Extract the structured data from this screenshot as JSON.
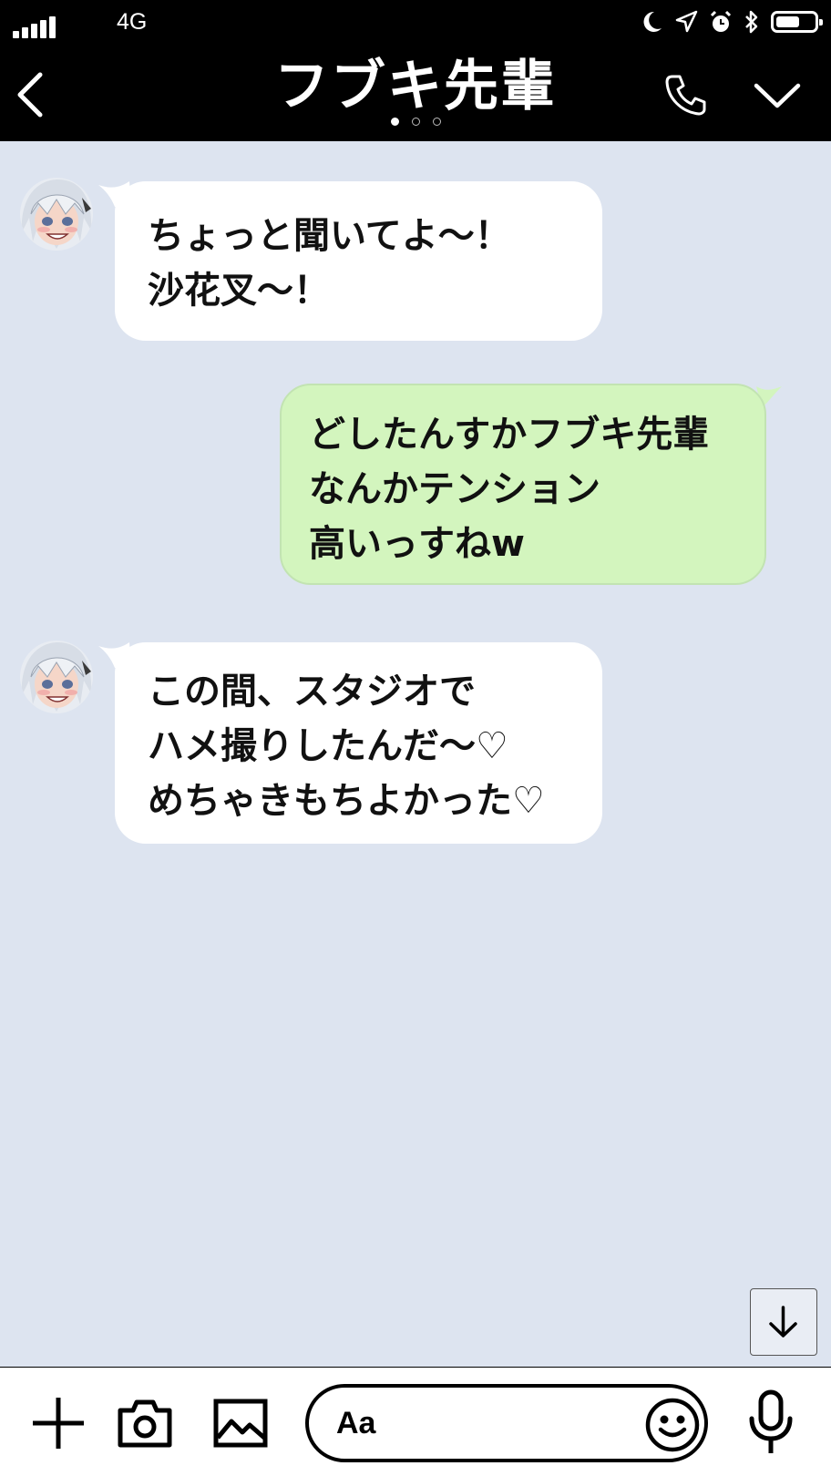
{
  "status_bar": {
    "network": "4G"
  },
  "header": {
    "title": "フブキ先輩",
    "page_dots": 3,
    "active_dot": 1
  },
  "messages": [
    {
      "side": "received",
      "lines": [
        "ちょっと聞いてよ～！",
        "沙花叉～！"
      ]
    },
    {
      "side": "sent",
      "lines": [
        "どしたんすかフブキ先輩",
        "なんかテンション",
        "高いっすねw"
      ]
    },
    {
      "side": "received",
      "lines": [
        "この間、スタジオで",
        "ハメ撮りしたんだ～♡",
        "めちゃきもちよかった♡"
      ]
    }
  ],
  "input": {
    "placeholder": "Aa"
  },
  "icons": {
    "back": "chevron-left-icon",
    "call": "phone-icon",
    "menu": "chevron-down-icon",
    "scroll": "arrow-down-icon",
    "add": "plus-icon",
    "camera": "camera-icon",
    "image": "image-icon",
    "emoji": "smiley-icon",
    "mic": "microphone-icon"
  },
  "colors": {
    "header_bg": "#000000",
    "chat_bg": "#dde4f0",
    "received_bubble": "#ffffff",
    "sent_bubble": "#d3f5be"
  }
}
